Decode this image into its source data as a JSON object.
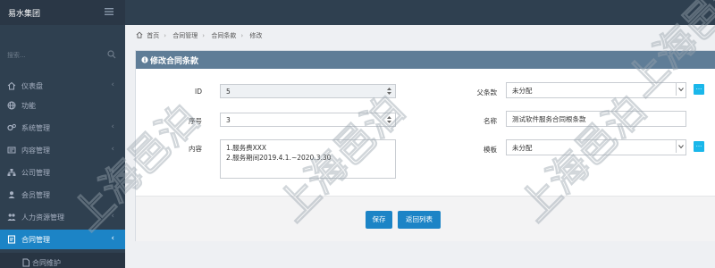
{
  "brand": {
    "name": "易水集团",
    "menu_icon": "hamburger-icon"
  },
  "sidebar": {
    "search_placeholder": "搜索...",
    "items": [
      {
        "label": "仪表盘",
        "icon": "home-icon",
        "has_arrow": true
      },
      {
        "label": "功能",
        "icon": "globe-icon",
        "has_arrow": false
      },
      {
        "label": "系统管理",
        "icon": "gears-icon",
        "has_arrow": true
      },
      {
        "label": "内容管理",
        "icon": "content-icon",
        "has_arrow": true
      },
      {
        "label": "公司管理",
        "icon": "org-icon",
        "has_arrow": true
      },
      {
        "label": "会员管理",
        "icon": "member-icon",
        "has_arrow": false
      },
      {
        "label": "人力资源管理",
        "icon": "hr-icon",
        "has_arrow": true
      },
      {
        "label": "合同管理",
        "icon": "contract-icon",
        "has_arrow": true,
        "active": true
      },
      {
        "label": "合同维护",
        "icon": "doc-icon",
        "sub": true
      }
    ]
  },
  "breadcrumb": [
    "首页",
    "合同管理",
    "合同条款",
    "修改"
  ],
  "panel": {
    "title": "修改合同条款"
  },
  "form": {
    "id_label": "ID",
    "id_value": "5",
    "seq_label": "序号",
    "seq_value": "3",
    "content_label": "内容",
    "content_value": "1.服务费XXX\n2.服务期间2019.4.1.~2020.3.30",
    "parent_label": "父条款",
    "parent_value": "未分配",
    "name_label": "名称",
    "name_value": "测试软件服务合同根条款",
    "template_label": "模板",
    "template_value": "未分配",
    "plus_label": "..."
  },
  "buttons": {
    "save": "保存",
    "back": "返回列表"
  },
  "watermark": {
    "text": "上海邑泊"
  },
  "colors": {
    "accent": "#1c84c6",
    "sidebar": "#2f4050",
    "panel_header": "#5f7d97",
    "plus": "#1ab7ea"
  }
}
